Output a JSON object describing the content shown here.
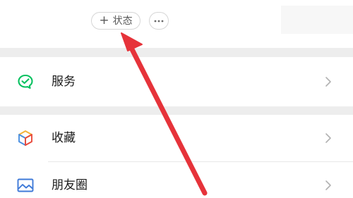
{
  "profile": {
    "status_button": {
      "plus": "+",
      "label": "状态"
    },
    "more_button": {
      "icon": "more-dots-icon"
    }
  },
  "menu": {
    "items": [
      {
        "label": "服务",
        "icon": "wechat-pay-icon",
        "icon_color": "#07c160"
      },
      {
        "label": "收藏",
        "icon": "cube-icon",
        "icon_colors": [
          "#f3b236",
          "#4a90e2",
          "#e94b3c"
        ]
      },
      {
        "label": "朋友圈",
        "icon": "photo-icon",
        "icon_color": "#3f7ad8"
      }
    ],
    "chevron_icon": "chevron-right-icon"
  },
  "annotation": {
    "arrow_color": "#e6333a"
  },
  "colors": {
    "page_background": "#ededed",
    "text": "#1a1a1a",
    "chevron": "#b2b2b2"
  }
}
